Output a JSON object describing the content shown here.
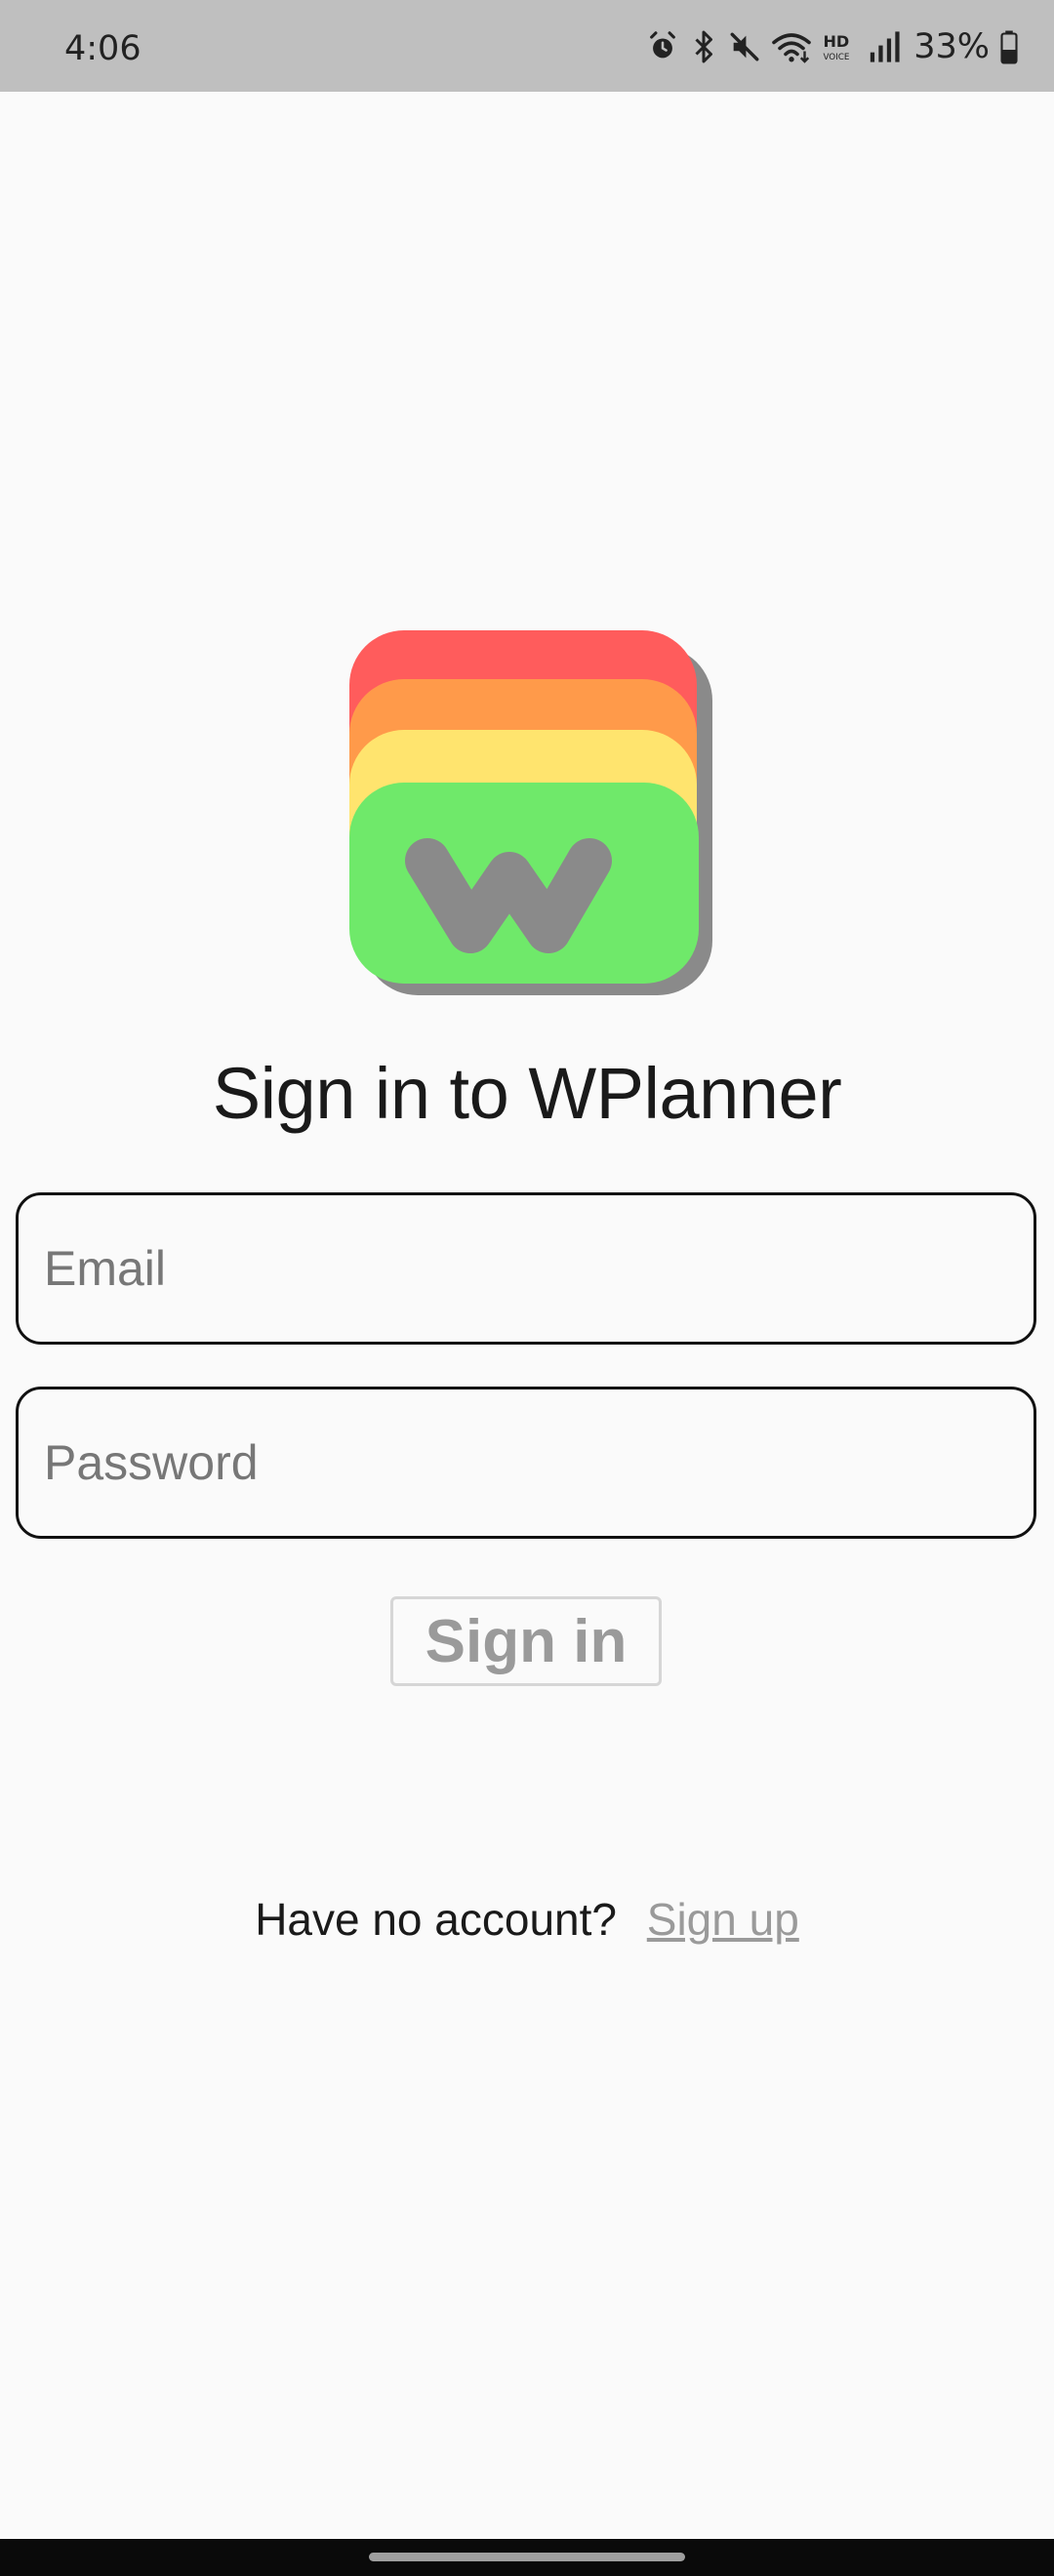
{
  "status_bar": {
    "time": "4:06",
    "battery_percent": "33%",
    "icons": [
      "alarm-icon",
      "bluetooth-icon",
      "mute-icon",
      "wifi-icon",
      "hd-voice-icon",
      "signal-icon",
      "battery-icon"
    ]
  },
  "app": {
    "logo": "wplanner-logo",
    "colors": {
      "red": "#ff5c5c",
      "orange": "#ff9a4a",
      "yellow": "#ffe46e",
      "green": "#6fe96a",
      "shadow": "#8a8a8a",
      "w": "#8a8a8a"
    }
  },
  "login": {
    "title": "Sign in to WPlanner",
    "email_placeholder": "Email",
    "email_value": "",
    "password_placeholder": "Password",
    "password_value": "",
    "signin_label": "Sign in",
    "no_account_text": "Have no account?",
    "signup_label": "Sign up"
  }
}
